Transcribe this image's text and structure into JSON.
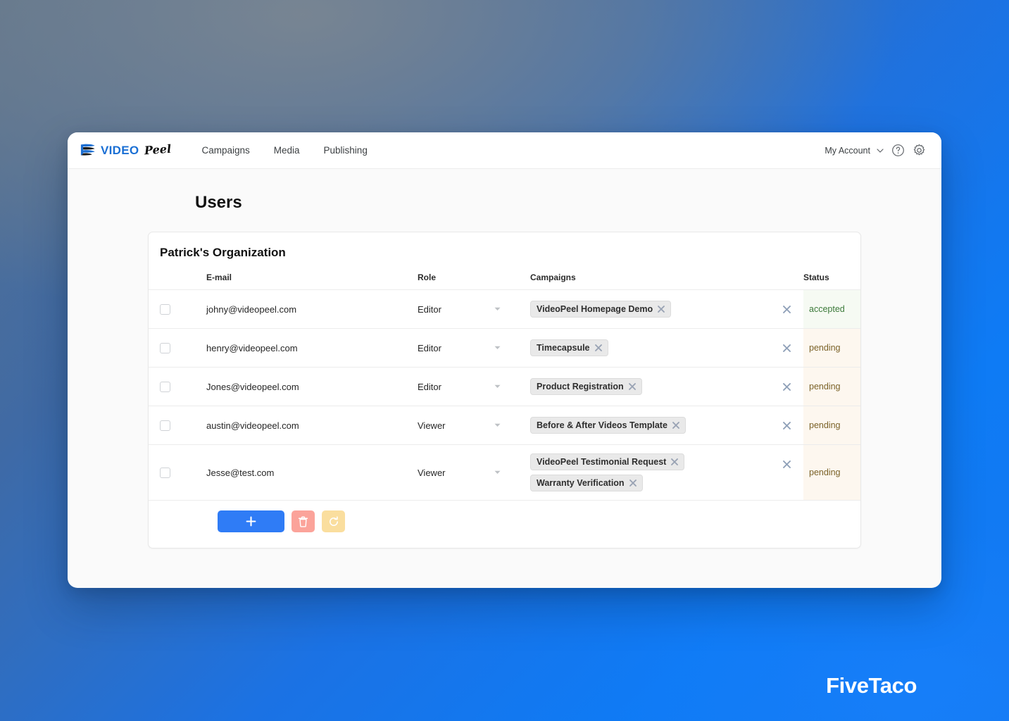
{
  "nav": {
    "brand_word": "VIDEO",
    "brand_script": "Peel",
    "links": [
      {
        "label": "Campaigns"
      },
      {
        "label": "Media"
      },
      {
        "label": "Publishing"
      }
    ],
    "account_label": "My Account",
    "help_icon": "question-circle-icon",
    "settings_icon": "gear-icon",
    "chevron_icon": "chevron-down-icon"
  },
  "page": {
    "title": "Users"
  },
  "card": {
    "title": "Patrick's Organization",
    "columns": {
      "checkbox": "",
      "email": "E-mail",
      "role": "Role",
      "campaigns": "Campaigns",
      "remove": "",
      "status": "Status"
    },
    "rows": [
      {
        "email": "johny@videopeel.com",
        "role": "Editor",
        "campaigns": [
          "VideoPeel Homepage Demo"
        ],
        "status": "accepted",
        "status_kind": "accepted"
      },
      {
        "email": "henry@videopeel.com",
        "role": "Editor",
        "campaigns": [
          "Timecapsule"
        ],
        "status": "pending",
        "status_kind": "pending"
      },
      {
        "email": "Jones@videopeel.com",
        "role": "Editor",
        "campaigns": [
          "Product Registration"
        ],
        "status": "pending",
        "status_kind": "pending"
      },
      {
        "email": "austin@videopeel.com",
        "role": "Viewer",
        "campaigns": [
          "Before & After Videos Template"
        ],
        "status": "pending",
        "status_kind": "pending"
      },
      {
        "email": "Jesse@test.com",
        "role": "Viewer",
        "campaigns": [
          "VideoPeel Testimonial Request",
          "Warranty Verification"
        ],
        "status": "pending",
        "status_kind": "pending"
      }
    ],
    "actions": {
      "add_icon": "plus-icon",
      "delete_icon": "trash-icon",
      "refresh_icon": "refresh-icon"
    }
  },
  "watermark": {
    "text": "FiveTaco"
  },
  "colors": {
    "brand_blue": "#1a6fd4",
    "add_button": "#2f7cf6",
    "delete_button": "#fba39a",
    "refresh_button": "#fade9e",
    "status_accepted_text": "#3c7a3a",
    "status_accepted_bg": "#f6faf3",
    "status_pending_text": "#7b6228",
    "status_pending_bg": "#fdf7ef",
    "tag_bg": "#e9e9e9",
    "page_bg": "#fafafa"
  }
}
